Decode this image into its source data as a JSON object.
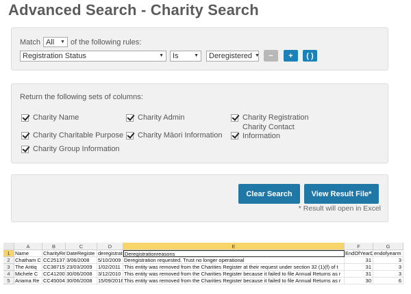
{
  "title": "Advanced Search - Charity Search",
  "rules": {
    "match_label": "Match",
    "match_value": "All",
    "match_suffix": "of the following rules:",
    "field_value": "Registration Status",
    "operator_value": "Is",
    "criteria_value": "Deregistered",
    "remove_label": "−",
    "add_label": "+",
    "group_label": "( )"
  },
  "columns": {
    "heading": "Return the following sets of columns:",
    "options": [
      {
        "label": "Charity Name",
        "checked": true
      },
      {
        "label": "Charity Admin",
        "checked": true
      },
      {
        "label": "Charity Registration",
        "checked": true
      },
      {
        "label": "Charity Charitable Purpose",
        "checked": true
      },
      {
        "label": "Charity Māori Information",
        "checked": true
      },
      {
        "label": "Charity Contact Information",
        "checked": true
      },
      {
        "label": "Charity Group Information",
        "checked": true
      }
    ]
  },
  "actions": {
    "clear_label": "Clear Search",
    "view_label": "View Result File*",
    "note": "* Result will open in Excel"
  },
  "spreadsheet": {
    "columns": [
      "A",
      "B",
      "C",
      "D",
      "E",
      "F",
      "G"
    ],
    "rows": [
      {
        "num": "1",
        "cells": [
          "Name",
          "CharityRe",
          "DateRegiste",
          "deregistrati",
          "Deregistrationreasons",
          "EndOfYearD",
          "endofyearm"
        ]
      },
      {
        "num": "2",
        "cells": [
          "Chatham C",
          "CC25137",
          "3/06/2008",
          "5/10/2009",
          "Deregistration requested. Trust no longer operational",
          "31",
          "3"
        ]
      },
      {
        "num": "3",
        "cells": [
          "The Antiq",
          "CC38715",
          "23/03/2009",
          "1/02/2011",
          "This entity was removed from the Charities Register at their request under section 32 (1)(f) of t",
          "31",
          "3"
        ]
      },
      {
        "num": "4",
        "cells": [
          "Michele C",
          "CC41200",
          "30/06/2008",
          "3/12/2010",
          "This entity was removed from the Charities Register because it failed to file Annual Returns as r",
          "31",
          "3"
        ]
      },
      {
        "num": "5",
        "cells": [
          "Ariama Re",
          "CC45004",
          "30/06/2008",
          "15/09/2016",
          "This entity was removed from the Charities Register because it failed to file Annual Returns as r",
          "30",
          "6"
        ]
      }
    ]
  }
}
